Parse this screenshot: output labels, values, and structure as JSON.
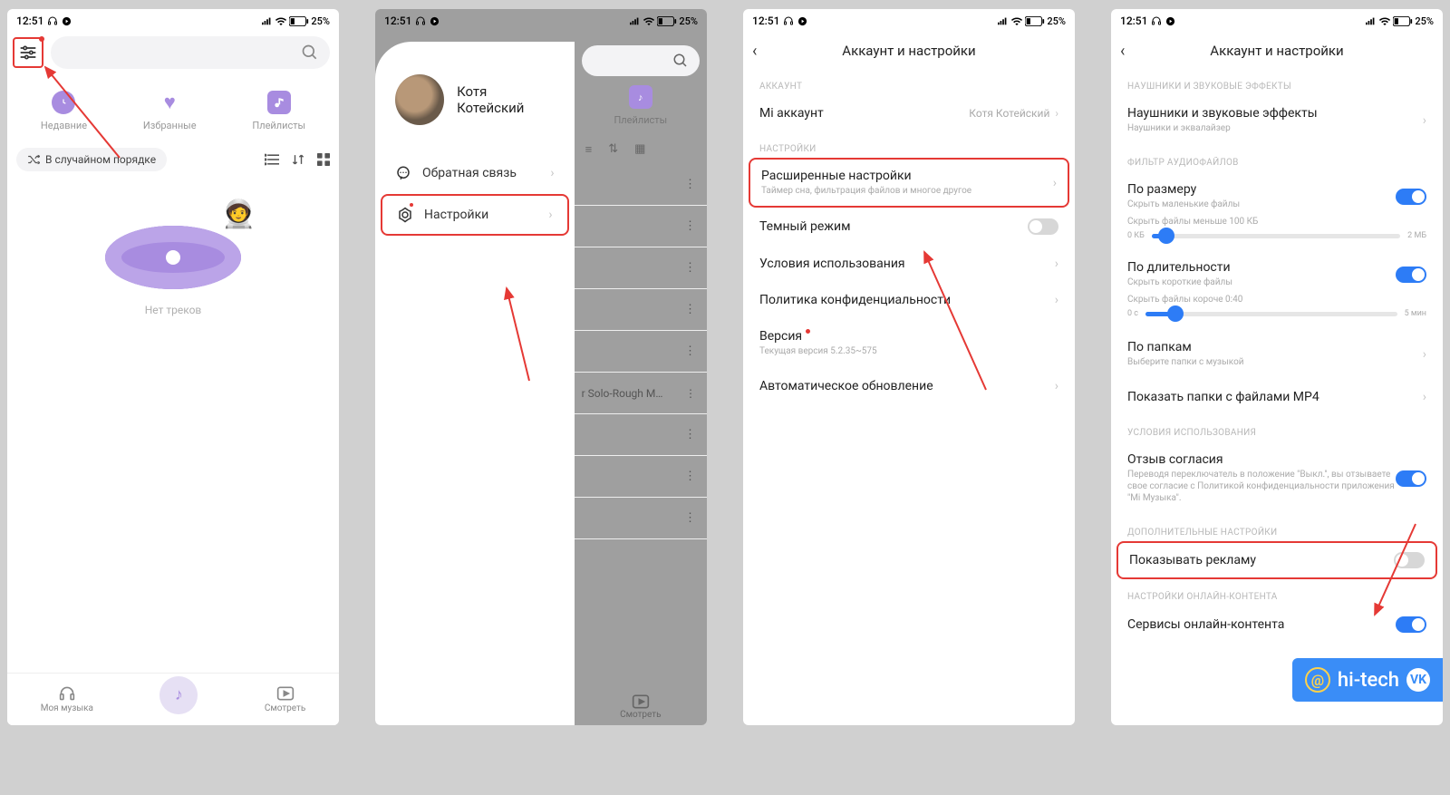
{
  "status": {
    "time": "12:51",
    "battery_pct": "25%"
  },
  "screen1": {
    "tabs": {
      "recent": "Недавние",
      "favorites": "Избранные",
      "playlists": "Плейлисты"
    },
    "shuffle": "В случайном порядке",
    "empty": "Нет треков",
    "nav": {
      "music": "Моя музыка",
      "watch": "Смотреть"
    }
  },
  "screen2": {
    "profile_name": "Котя Котейский",
    "feedback": "Обратная связь",
    "settings": "Настройки",
    "playlists": "Плейлисты",
    "bg_track": "r Solo-Rough M…",
    "nav_watch": "Смотреть"
  },
  "screen3": {
    "title": "Аккаунт и настройки",
    "sect_account": "АККАУНТ",
    "mi_account": "Mi аккаунт",
    "mi_account_val": "Котя Котейский",
    "sect_settings": "НАСТРОЙКИ",
    "advanced": "Расширенные настройки",
    "advanced_sub": "Таймер сна, фильтрация файлов и многое другое",
    "dark": "Темный режим",
    "terms": "Условия использования",
    "privacy": "Политика конфиденциальности",
    "version": "Версия",
    "version_sub": "Текущая версия 5.2.35~575",
    "autoupdate": "Автоматическое обновление"
  },
  "screen4": {
    "title": "Аккаунт и настройки",
    "sect_headphones": "НАУШНИКИ И ЗВУКОВЫЕ ЭФФЕКТЫ",
    "headphones": "Наушники и звуковые эффекты",
    "headphones_sub": "Наушники и эквалайзер",
    "sect_filter": "ФИЛЬТР АУДИОФАЙЛОВ",
    "by_size": "По размеру",
    "by_size_sub": "Скрыть маленькие файлы",
    "size_hint": "Скрыть файлы меньше 100 КБ",
    "size_min": "0 КБ",
    "size_max": "2 МБ",
    "by_duration": "По длительности",
    "by_duration_sub": "Скрыть короткие файлы",
    "dur_hint": "Скрыть файлы короче 0:40",
    "dur_min": "0 с",
    "dur_max": "5 мин",
    "by_folder": "По папкам",
    "by_folder_sub": "Выберите папки с музыкой",
    "mp4": "Показать папки с файлами MP4",
    "sect_terms": "УСЛОВИЯ ИСПОЛЬЗОВАНИЯ",
    "consent": "Отзыв согласия",
    "consent_sub": "Переводя переключатель в положение \"Выкл.\", вы отзываете свое согласие с Политикой конфиденциальности приложения \"Mi Музыка\".",
    "sect_extra": "ДОПОЛНИТЕЛЬНЫЕ НАСТРОЙКИ",
    "ads": "Показывать рекламу",
    "sect_online": "НАСТРОЙКИ ОНЛАЙН-КОНТЕНТА",
    "services": "Сервисы онлайн-контента",
    "watermark": "hi-tech"
  }
}
